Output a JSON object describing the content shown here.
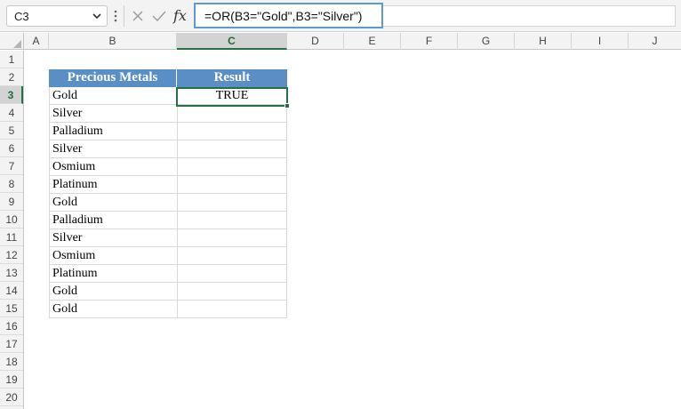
{
  "formula_bar": {
    "name_box": "C3",
    "formula": "=OR(B3=\"Gold\",B3=\"Silver\")"
  },
  "columns": [
    "A",
    "B",
    "C",
    "D",
    "E",
    "F",
    "G",
    "H",
    "I",
    "J"
  ],
  "selected_column": "C",
  "rows": [
    "1",
    "2",
    "3",
    "4",
    "5",
    "6",
    "7",
    "8",
    "9",
    "10",
    "11",
    "12",
    "13",
    "14",
    "15",
    "16",
    "17",
    "18",
    "19",
    "20"
  ],
  "selected_row": "3",
  "table": {
    "headers": [
      "Precious Metals",
      "Result"
    ],
    "header_color": "#5a8ec4",
    "metals": [
      "Gold",
      "Silver",
      "Palladium",
      "Silver",
      "Osmium",
      "Platinum",
      "Gold",
      "Palladium",
      "Silver",
      "Osmium",
      "Platinum",
      "Gold",
      "Gold"
    ],
    "results": [
      "TRUE",
      "",
      "",
      "",
      "",
      "",
      "",
      "",
      "",
      "",
      "",
      "",
      ""
    ]
  },
  "active_cell": "C3",
  "accent_color": "#217346"
}
